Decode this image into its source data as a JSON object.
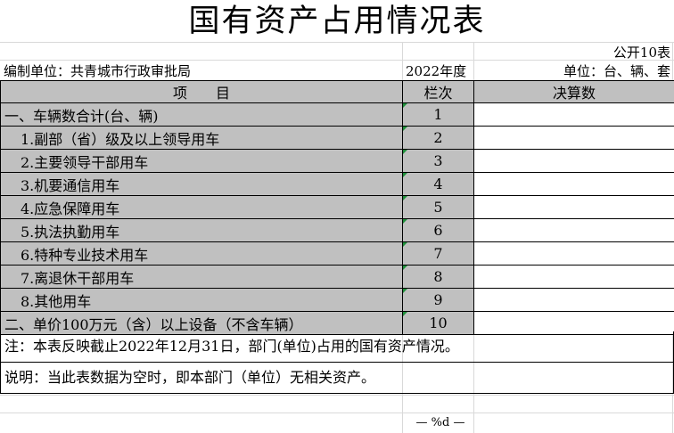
{
  "title": "国有资产占用情况表",
  "form_no": "公开10表",
  "unit_label": "编制单位：共青城市行政审批局",
  "year": "2022年度",
  "measure_unit": "单位：台、辆、套",
  "columns": {
    "item": "项　　目",
    "row_no": "栏次",
    "final_count": "决算数"
  },
  "rows": [
    {
      "label": "一、车辆数合计(台、辆)",
      "no": "1",
      "value": "",
      "level": 0
    },
    {
      "label": "1.副部（省）级及以上领导用车",
      "no": "2",
      "value": "",
      "level": 1
    },
    {
      "label": "2.主要领导干部用车",
      "no": "3",
      "value": "",
      "level": 1
    },
    {
      "label": "3.机要通信用车",
      "no": "4",
      "value": "",
      "level": 1
    },
    {
      "label": "4.应急保障用车",
      "no": "5",
      "value": "",
      "level": 1
    },
    {
      "label": "5.执法执勤用车",
      "no": "6",
      "value": "",
      "level": 1
    },
    {
      "label": "6.特种专业技术用车",
      "no": "7",
      "value": "",
      "level": 1
    },
    {
      "label": "7.离退休干部用车",
      "no": "8",
      "value": "",
      "level": 1
    },
    {
      "label": "8.其他用车",
      "no": "9",
      "value": "",
      "level": 1
    },
    {
      "label": "二、单价100万元（含）以上设备（不含车辆）",
      "no": "10",
      "value": "",
      "level": 0
    }
  ],
  "notes": [
    "注：本表反映截止2022年12月31日，部门(单位)占用的国有资产情况。",
    "说明：当此表数据为空时，即本部门（单位）无相关资产。"
  ],
  "page_footer": "— %d —",
  "colors": {
    "header_bg": "#c0c0c0",
    "grid": "#d9d9d9",
    "cell_marker": "#1f8f3a"
  }
}
